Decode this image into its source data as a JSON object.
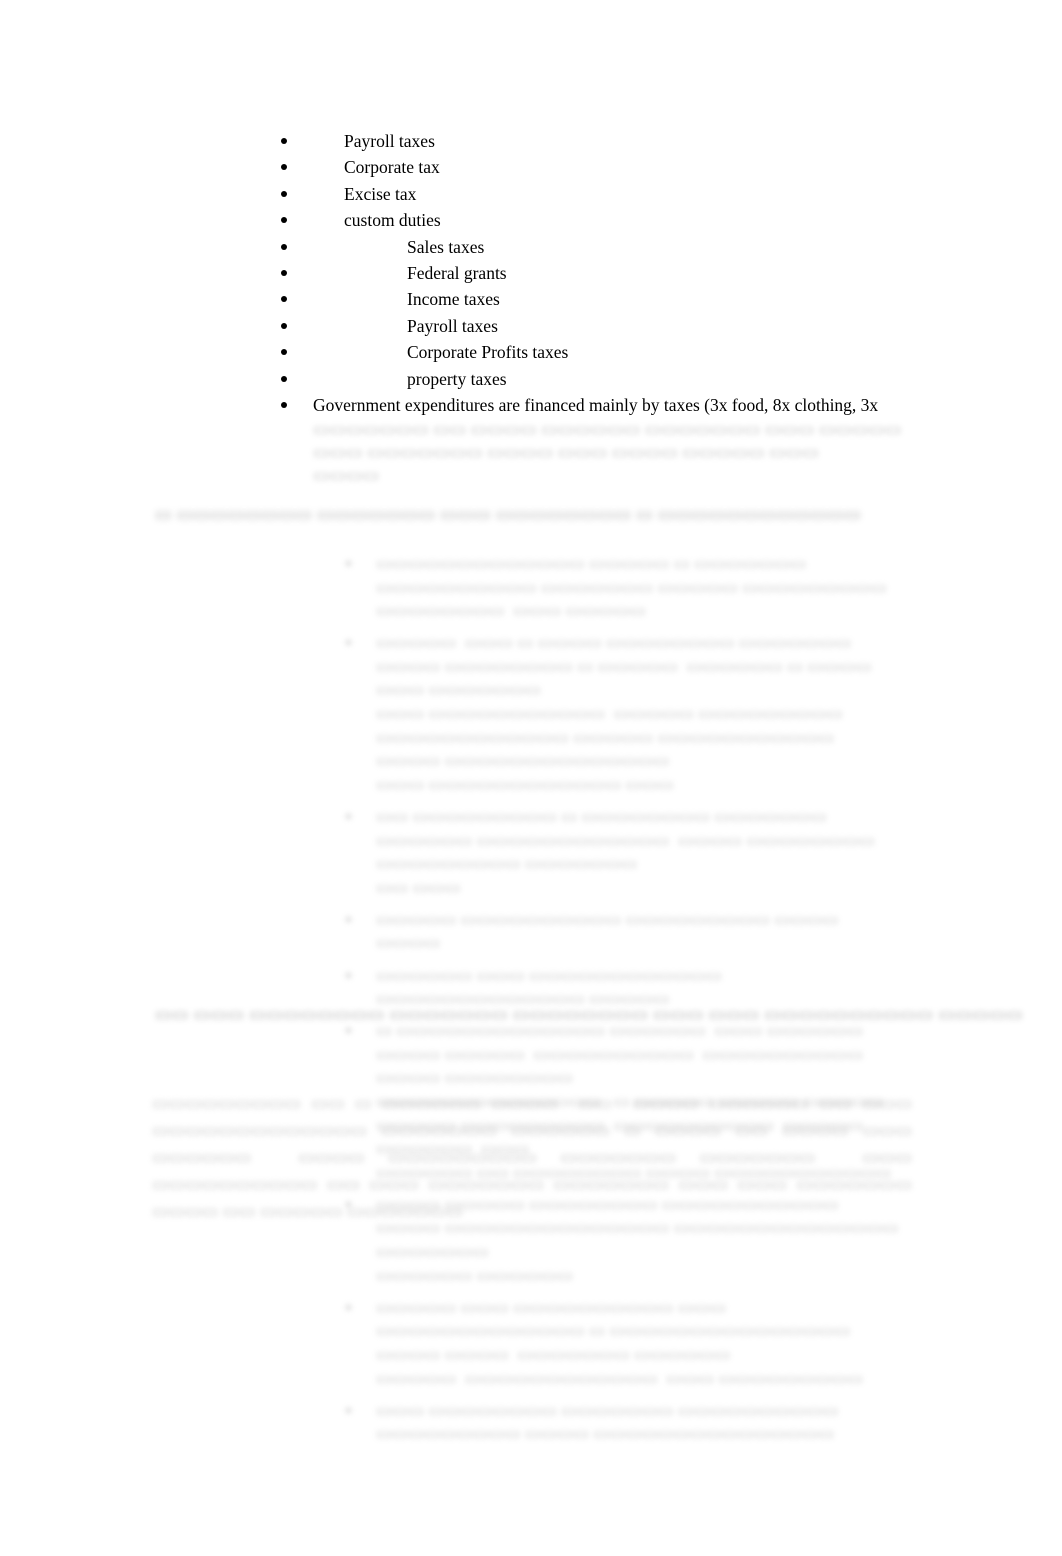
{
  "document": {
    "page_background": "#ffffff",
    "text_color": "#000000",
    "blurred_text_color": "#bcbcbc"
  },
  "top_list": {
    "items": [
      {
        "label": "Payroll taxes",
        "indent": "lv1",
        "legible": true
      },
      {
        "label": "Corporate tax",
        "indent": "lv1",
        "legible": true
      },
      {
        "label": "Excise tax",
        "indent": "lv1",
        "legible": true
      },
      {
        "label": "custom duties",
        "indent": "lv1",
        "legible": true
      },
      {
        "label": "Sales taxes",
        "indent": "lv2",
        "legible": true
      },
      {
        "label": "Federal grants",
        "indent": "lv2",
        "legible": true
      },
      {
        "label": "Income taxes",
        "indent": "lv2",
        "legible": true
      },
      {
        "label": "Payroll taxes",
        "indent": "lv2",
        "legible": true
      },
      {
        "label": "Corporate Profits taxes",
        "indent": "lv2",
        "legible": true
      },
      {
        "label": "property taxes",
        "indent": "lv2",
        "legible": true
      },
      {
        "label": "Government expenditures are financed mainly by taxes (3x food, 8x clothing, 3x",
        "indent": "lv0",
        "legible": true
      }
    ],
    "continuation_lines": [
      "▭▭▭▭▭▭▭ ▭▭ ▭▭▭▭ ▭▭▭▭▭▭ ▭▭▭▭▭▭▭ ▭▭▭ ▭▭▭▭▭ ▭▭▭ ▭▭▭▭▭▭▭ ▭▭▭▭ ▭▭▭ ▭▭▭▭  ▭▭▭▭▭  ▭▭▭",
      "▭▭▭▭"
    ]
  },
  "heading_1": {
    "text": "▭ ▭▭▭▭▭▭▭▭ ▭▭▭▭▭▭▭ ▭▭▭ ▭▭▭▭▭▭▭▭  ▭ ▭▭▭▭▭▭▭▭▭▭▭▭"
  },
  "middle_list": {
    "items": [
      {
        "lines": [
          "▭▭▭▭▭▭▭▭▭▭▭▭▭ ▭▭▭▭▭ ▭ ▭▭▭▭▭▭▭ ▭▭▭▭▭▭▭▭▭▭ ▭▭▭▭▭▭▭ ▭▭▭▭▭ ▭▭▭▭▭▭▭▭▭",
          "▭▭▭▭▭▭▭▭  ▭▭▭ ▭▭▭▭▭"
        ]
      },
      {
        "lines": [
          "▭▭▭▭▭  ▭▭▭ ▭ ▭▭▭▭ ▭▭▭▭▭▭▭▭ ▭▭▭▭▭▭▭ ▭▭▭▭ ▭▭▭▭▭▭▭▭ ▭ ▭▭▭▭▭  ▭▭▭▭▭▭ ▭ ▭▭▭▭ ▭▭▭ ▭▭▭▭▭▭▭",
          "▭▭▭ ▭▭▭▭▭▭▭▭▭▭▭  ▭▭▭▭▭ ▭▭▭▭▭▭▭▭▭  ▭▭▭▭▭▭▭▭▭▭▭▭ ▭▭▭▭▭ ▭▭▭▭▭▭▭▭▭▭▭ ▭▭▭▭ ▭▭▭▭▭▭▭▭▭▭▭▭▭▭",
          "▭▭▭ ▭▭▭▭▭▭▭▭▭▭▭▭ ▭▭▭"
        ]
      },
      {
        "lines": [
          "▭▭ ▭▭▭▭▭▭▭▭▭ ▭ ▭▭▭▭▭▭▭▭ ▭▭▭▭▭▭▭  ▭▭▭▭▭▭ ▭▭▭▭▭▭▭▭▭▭▭▭  ▭▭▭▭ ▭▭▭▭▭▭▭▭ ▭▭▭▭▭▭▭▭▭ ▭▭▭▭▭▭▭",
          "▭▭ ▭▭▭"
        ]
      },
      {
        "lines": [
          "▭▭▭▭▭ ▭▭▭▭▭▭▭▭▭▭ ▭▭▭▭▭▭▭▭▭ ▭▭▭▭  ▭▭▭▭"
        ]
      },
      {
        "lines": [
          "▭▭▭▭▭▭ ▭▭▭ ▭▭▭▭▭▭▭▭▭▭▭▭ ▭▭▭▭▭▭▭▭▭▭▭▭▭ ▭▭▭▭▭"
        ]
      },
      {
        "lines": [
          "▭ ▭▭▭▭▭▭▭▭▭▭▭▭▭ ▭▭▭▭▭▭  ▭▭▭ ▭▭▭▭▭▭ ▭▭▭▭ ▭▭▭▭▭  ▭▭▭▭▭▭▭▭▭▭  ▭▭▭▭▭▭▭▭▭▭ ▭▭▭▭ ▭▭▭▭▭▭▭▭",
          "▭▭▭▭▭▭▭▭▭▭▭▭▭▭   ▭ ▭▭▭▭▭ ▭▭▭▭▭ ▭▭▭▭▭ ▭▭▭▭▭ ▭▭▭▭▭▭▭▭▭  ▭▭▭▭▭▭▭▭▭▭  ▭▭▭▭▭ ▭▭▭▭▭▭  ▭▭▭",
          "▭▭▭▭▭▭ ▭▭ ▭▭▭▭▭▭▭▭ ▭▭▭▭ ▭▭▭▭▭▭▭▭▭▭▭"
        ]
      },
      {
        "lines": [
          "▭▭▭▭ ▭▭▭▭▭ ▭▭▭▭▭▭▭▭ ▭▭▭▭▭▭▭▭▭▭▭ ▭▭▭▭ ▭▭▭▭▭▭▭▭▭▭▭▭▭▭ ▭▭▭▭▭▭▭▭▭▭▭▭▭▭ ▭▭▭▭▭▭▭",
          "▭▭▭▭▭▭ ▭▭▭▭▭▭"
        ]
      },
      {
        "lines": [
          "▭▭▭▭▭ ▭▭▭ ▭▭▭▭▭▭▭▭▭▭ ▭▭▭ ▭▭▭▭▭▭▭▭▭▭▭▭▭ ▭ ▭▭▭▭▭▭▭▭▭▭▭▭▭▭▭ ▭▭▭▭ ▭▭▭▭  ▭▭▭▭▭▭▭ ▭▭▭▭▭▭",
          "▭▭▭▭▭  ▭▭▭▭▭▭▭▭▭▭▭▭  ▭▭▭ ▭▭▭▭▭▭▭▭▭"
        ]
      },
      {
        "lines": [
          "▭▭▭ ▭▭▭▭▭▭▭▭ ▭▭▭▭▭▭▭ ▭▭▭▭▭▭▭▭▭▭ ▭▭▭▭▭▭▭▭▭ ▭▭▭▭ ▭▭▭▭▭▭▭▭▭▭▭▭▭▭▭"
        ]
      }
    ]
  },
  "heading_2": {
    "text": "▭▭ ▭▭▭ ▭▭▭▭▭▭▭▭ ▭▭▭▭▭▭▭ ▭▭▭▭▭▭▭▭ ▭▭▭ ▭▭▭ ▭▭▭▭▭▭▭▭▭▭ ▭▭▭▭▭"
  },
  "closing_paragraph": {
    "text": "▭▭▭▭▭▭▭▭▭ ▭▭ ▭ ▭▭▭▭▭▭ ▭▭▭▭  ▭▭  ▭▭▭▭ ▭▭▭▭▭▭ ▭▭ ▭▭▭ ▭▭▭▭▭▭▭▭▭▭▭▭▭ ▭▭▭▭▭▭▭ ▭▭▭▭▭▭ ▭ ▭▭▭▭ ▭▭ ▭▭▭▭ ▭▭▭ ▭▭▭▭▭▭  ▭▭▭▭ ▭▭▭▭▭▭▭▭▭ ▭▭▭▭▭▭▭ ▭▭▭▭▭▭▭  ▭▭▭ ▭▭▭▭▭▭▭▭▭▭ ▭▭ ▭▭▭ ▭▭▭▭▭▭▭ ▭▭▭▭▭▭▭ ▭▭▭ ▭▭▭ ▭▭▭▭▭▭▭ ▭▭▭▭ ▭▭ ▭▭▭▭▭ ▭▭▭▭▭▭▭"
  }
}
